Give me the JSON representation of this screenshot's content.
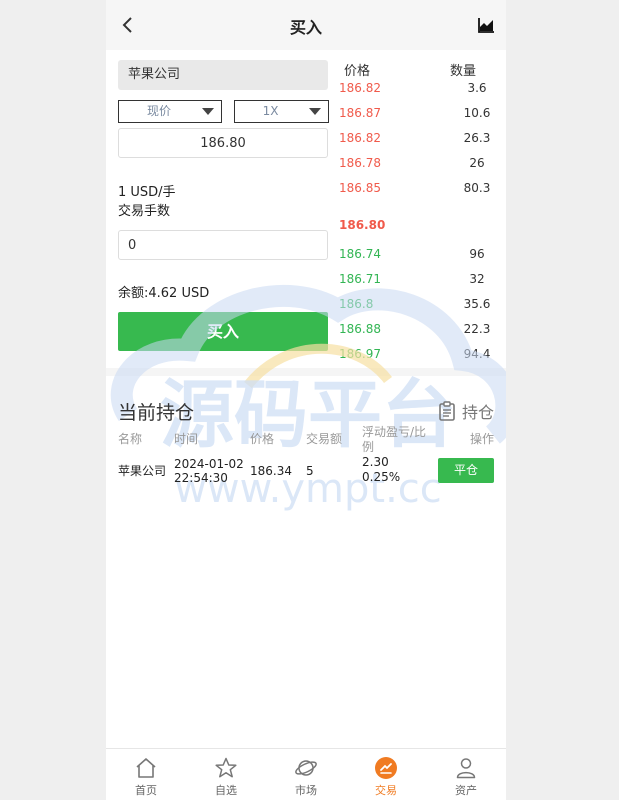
{
  "header": {
    "title": "买入",
    "back_icon": "chevron-left-icon",
    "chart_icon": "area-chart-icon"
  },
  "form": {
    "stock_name": "苹果公司",
    "order_type": "现价",
    "leverage": "1X",
    "price": "186.80",
    "unit_line1": "1 USD/手",
    "unit_line2": "交易手数",
    "quantity": "0",
    "balance": "余额:4.62 USD",
    "buy_label": "买入"
  },
  "order_book": {
    "price_header": "价格",
    "qty_header": "数量",
    "asks": [
      {
        "price": "186.82",
        "qty": "3.6"
      },
      {
        "price": "186.87",
        "qty": "10.6"
      },
      {
        "price": "186.82",
        "qty": "26.3"
      },
      {
        "price": "186.78",
        "qty": "26"
      },
      {
        "price": "186.85",
        "qty": "80.3"
      }
    ],
    "current": "186.80",
    "bids": [
      {
        "price": "186.74",
        "qty": "96"
      },
      {
        "price": "186.71",
        "qty": "32"
      },
      {
        "price": "186.8",
        "qty": "35.6"
      },
      {
        "price": "186.88",
        "qty": "22.3"
      },
      {
        "price": "186.97",
        "qty": "94.4"
      }
    ],
    "colors": {
      "ask": "#f05a4b",
      "bid": "#32b553"
    }
  },
  "holdings": {
    "title": "当前持仓",
    "link_label": "持仓",
    "columns": {
      "name": "名称",
      "time": "时间",
      "price": "价格",
      "amount": "交易额",
      "pnl_line1": "浮动盈亏/比",
      "pnl_line2": "例",
      "action": "操作"
    },
    "rows": [
      {
        "name": "苹果公司",
        "date": "2024-01-02",
        "time": "22:54:30",
        "price": "186.34",
        "amount": "5",
        "pnl": "2.30",
        "pnl_pct": "0.25%",
        "action_label": "平仓"
      }
    ]
  },
  "watermark": {
    "brand": "源码平台",
    "url": "www.ympt.cc"
  },
  "nav": {
    "items": [
      {
        "label": "首页",
        "icon": "home-icon"
      },
      {
        "label": "自选",
        "icon": "star-icon"
      },
      {
        "label": "市场",
        "icon": "planet-icon"
      },
      {
        "label": "交易",
        "icon": "trade-icon"
      },
      {
        "label": "资产",
        "icon": "user-icon"
      }
    ],
    "active": "交易",
    "accent": "#f07b22"
  },
  "colors": {
    "buy_green": "#37b94f"
  }
}
